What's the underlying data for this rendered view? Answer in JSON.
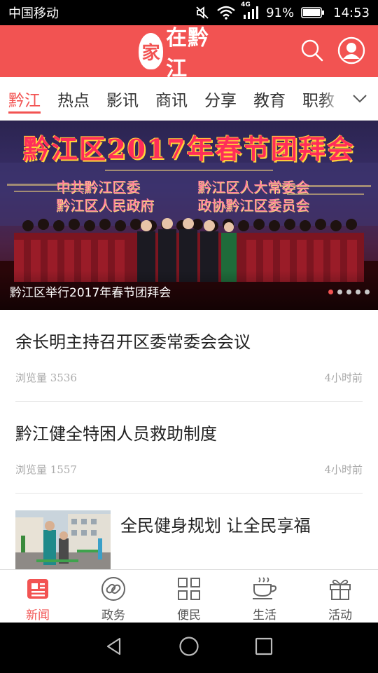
{
  "status_bar": {
    "carrier": "中国移动",
    "network": "4G",
    "battery_percent": "91%",
    "time": "14:53",
    "icons": [
      "mute-icon",
      "wifi-icon",
      "signal-icon",
      "battery-icon"
    ]
  },
  "header": {
    "logo_badge": "家",
    "logo_text": "在黔江",
    "icons": [
      "search-icon",
      "user-icon"
    ],
    "colors": {
      "brand": "#f25352"
    }
  },
  "tabs": {
    "items": [
      {
        "label": "黔江",
        "active": true
      },
      {
        "label": "热点",
        "active": false
      },
      {
        "label": "影讯",
        "active": false
      },
      {
        "label": "商讯",
        "active": false
      },
      {
        "label": "分享",
        "active": false
      },
      {
        "label": "教育",
        "active": false
      },
      {
        "label": "职教",
        "active": false
      }
    ],
    "more_icon": "chevron-down-icon"
  },
  "banner": {
    "headline_art": "黔江区2017年春节团拜会",
    "sub_art_left": [
      "中共黔江区委",
      "黔江区人民政府"
    ],
    "sub_art_right": [
      "黔江区人大常委会",
      "政协黔江区委员会"
    ],
    "caption": "黔江区举行2017年春节团拜会",
    "slide_count": 5,
    "active_slide": 1
  },
  "news": [
    {
      "title": "余长明主持召开区委常委会会议",
      "views": "浏览量 3536",
      "time": "4小时前"
    },
    {
      "title": "黔江健全特困人员救助制度",
      "views": "浏览量 1557",
      "time": "4小时前"
    },
    {
      "title": "全民健身规划 让全民享福"
    }
  ],
  "bottom_nav": [
    {
      "label": "新闻",
      "icon": "news-icon",
      "active": true
    },
    {
      "label": "政务",
      "icon": "link-icon",
      "active": false
    },
    {
      "label": "便民",
      "icon": "grid-icon",
      "active": false
    },
    {
      "label": "生活",
      "icon": "coffee-icon",
      "active": false
    },
    {
      "label": "活动",
      "icon": "gift-icon",
      "active": false
    }
  ],
  "system_nav": [
    "back-icon",
    "home-icon",
    "recents-icon"
  ]
}
